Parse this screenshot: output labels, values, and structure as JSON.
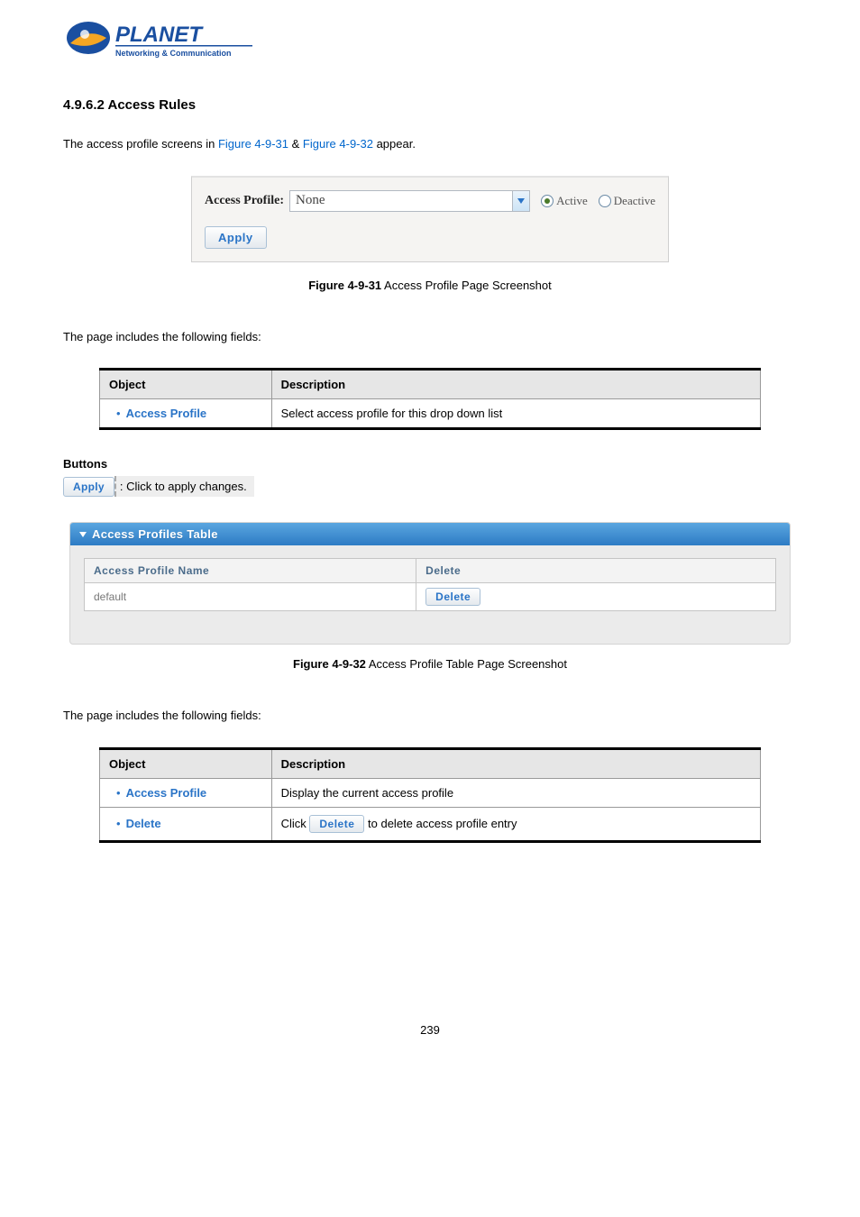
{
  "logo": {
    "brand": "PLANET",
    "tagline": "Networking & Communication"
  },
  "section_heading": "4.9.6.2 Access Rules",
  "intro": {
    "pre": "The access profile screens in ",
    "fig1": "Figure 4-9-31",
    "mid": " & ",
    "fig2": "Figure 4-9-32",
    "post": " appear."
  },
  "panel1": {
    "label": "Access Profile:",
    "select_value": "None",
    "radio_active": "Active",
    "radio_deactive": "Deactive",
    "apply": "Apply"
  },
  "caption1": {
    "bold": "Figure 4-9-31",
    "rest": " Access Profile Page Screenshot"
  },
  "fields_intro": "The page includes the following fields:",
  "table1": {
    "col_object": "Object",
    "col_desc": "Description",
    "rows": [
      {
        "object": "Access Profile",
        "desc": "Select access profile for this drop down list"
      }
    ]
  },
  "buttons_heading": "Buttons",
  "apply_btn_label": "Apply",
  "apply_btn_desc": ": Click to apply changes.",
  "panel2": {
    "title": "Access Profiles Table",
    "col_name": "Access Profile Name",
    "col_delete": "Delete",
    "rows": [
      {
        "name": "default",
        "delete": "Delete"
      }
    ]
  },
  "caption2": {
    "bold": "Figure 4-9-32",
    "rest": " Access Profile Table Page Screenshot"
  },
  "fields_intro2": "The page includes the following fields:",
  "table2": {
    "col_object": "Object",
    "col_desc": "Description",
    "rows": [
      {
        "object": "Access Profile",
        "desc": "Display the current access profile"
      },
      {
        "object": "Delete",
        "desc_pre": "Click ",
        "btn": "Delete",
        "desc_post": " to delete access profile entry"
      }
    ]
  },
  "page_number": "239"
}
